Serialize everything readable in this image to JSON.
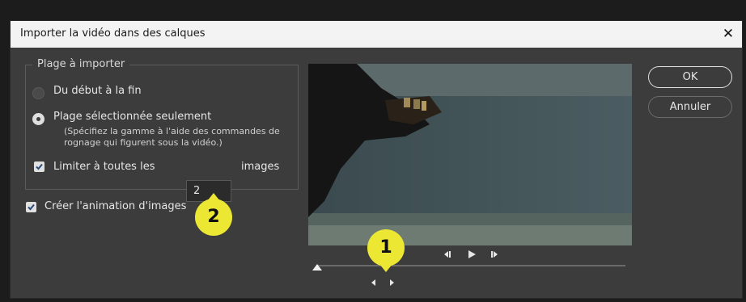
{
  "dialog": {
    "title": "Importer la vidéo dans des calques",
    "close_glyph": "✕"
  },
  "range_group": {
    "legend": "Plage à importer",
    "option_full": "Du début à la fin",
    "option_selected": "Plage sélectionnée seulement",
    "selected_option": "option_selected",
    "hint": "(Spécifiez la gamme à l'aide des commandes de rognage qui figurent sous la vidéo.)",
    "limit_checked": true,
    "limit_label": "Limiter à toutes les",
    "limit_value": "2",
    "limit_unit": "images"
  },
  "create_animation": {
    "checked": true,
    "label": "Créer l'animation d'images"
  },
  "callouts": {
    "first": "1",
    "second": "2",
    "color": "#ece733"
  },
  "playback": {
    "icons": [
      "step-back-icon",
      "play-icon",
      "step-forward-icon"
    ],
    "prev_glyph": "◂▮",
    "play_glyph": "▶",
    "next_glyph": "▮▸"
  },
  "buttons": {
    "ok": "OK",
    "cancel": "Annuler"
  },
  "colors": {
    "dialog_bg": "#3c3c3c",
    "titlebar_bg": "#f3f3f3",
    "accent_callout": "#ece733"
  }
}
